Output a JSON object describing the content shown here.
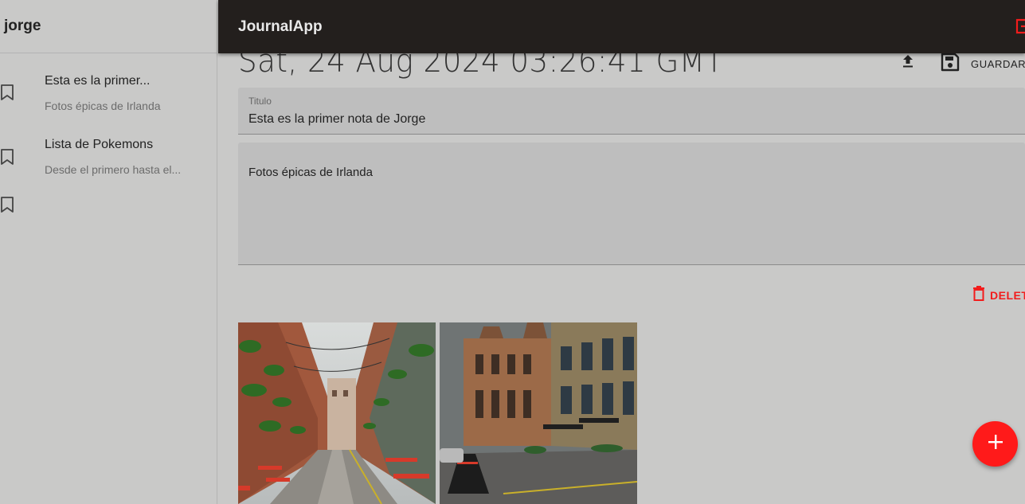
{
  "sidebar": {
    "username": "jorge",
    "notes": [
      {
        "title": "Esta es la primer...",
        "subtitle": "Fotos épicas de Irlanda",
        "icon": "bookmark-icon"
      },
      {
        "title": "Lista de Pokemons",
        "subtitle": "Desde el primero hasta el...",
        "icon": "bookmark-icon"
      },
      {
        "title": "",
        "subtitle": "",
        "icon": "bookmark-icon"
      }
    ]
  },
  "topbar": {
    "app_title": "JournalApp",
    "logout_icon": "logout-icon"
  },
  "note": {
    "date": "Sat, 24 Aug 2024 03:26:41 GMT",
    "upload_icon": "upload-icon",
    "save_icon": "save-icon",
    "save_label": "GUARDAR",
    "title_label": "Titulo",
    "title_value": "Esta es la primer nota de Jorge",
    "body_value": "Fotos épicas de Irlanda",
    "delete_label": "DELETE",
    "delete_icon": "trash-icon",
    "images": [
      "street-alley-photo",
      "historic-building-photo"
    ]
  },
  "fab": {
    "icon": "plus-icon"
  },
  "colors": {
    "background": "#c9c9c8",
    "topbar": "#231f1d",
    "accent": "#ff1a1a"
  }
}
